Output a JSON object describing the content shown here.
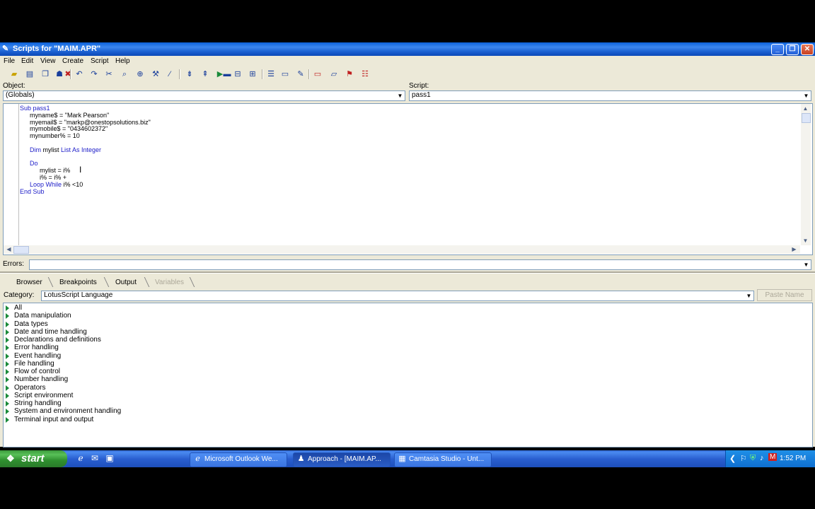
{
  "window": {
    "title": "Scripts for \"MAIM.APR\"",
    "controls": [
      "_",
      "❐",
      "✕"
    ]
  },
  "menu": [
    "File",
    "Edit",
    "View",
    "Create",
    "Script",
    "Help"
  ],
  "toolbar_icons": [
    "open-icon",
    "new-icon",
    "copy-icon",
    "paste-icon",
    "user-icon",
    "delete-icon",
    "undo-icon",
    "redo-icon",
    "cut-icon",
    "find-icon",
    "replace-icon",
    "browse-icon",
    "tools-icon",
    "wand-icon",
    "step-into-icon",
    "step-over-icon",
    "run-icon",
    "stop-icon",
    "breakpoint-icon",
    "watch-icon",
    "list-icon",
    "window-icon",
    "edit-icon",
    "button-icon",
    "field-icon",
    "macro-icon",
    "properties-icon"
  ],
  "object": {
    "label": "Object:",
    "value": "(Globals)"
  },
  "script": {
    "label": "Script:",
    "value": "pass1"
  },
  "code_lines": [
    {
      "indent": 0,
      "parts": [
        {
          "t": "Sub pass1",
          "kw": true
        }
      ]
    },
    {
      "indent": 1,
      "parts": [
        {
          "t": "myname$ = \"Mark Pearson\"",
          "kw": false
        }
      ]
    },
    {
      "indent": 1,
      "parts": [
        {
          "t": "myemail$ = \"markp@onestopsolutions.biz\"",
          "kw": false
        }
      ]
    },
    {
      "indent": 1,
      "parts": [
        {
          "t": "mymobile$ = \"0434602372\"",
          "kw": false
        }
      ]
    },
    {
      "indent": 1,
      "parts": [
        {
          "t": "mynumber% = 10",
          "kw": false
        }
      ]
    },
    {
      "indent": 1,
      "parts": []
    },
    {
      "indent": 1,
      "parts": [
        {
          "t": "Dim ",
          "kw": true
        },
        {
          "t": "mylist ",
          "kw": false
        },
        {
          "t": "List As Integer",
          "kw": true
        }
      ]
    },
    {
      "indent": 1,
      "parts": []
    },
    {
      "indent": 1,
      "parts": [
        {
          "t": "Do",
          "kw": true
        }
      ]
    },
    {
      "indent": 2,
      "parts": [
        {
          "t": "mylist = i%",
          "kw": false
        }
      ]
    },
    {
      "indent": 2,
      "parts": [
        {
          "t": "i% = i% +",
          "kw": false
        }
      ]
    },
    {
      "indent": 1,
      "parts": [
        {
          "t": "Loop While ",
          "kw": true
        },
        {
          "t": "i% <10",
          "kw": false
        }
      ]
    },
    {
      "indent": 0,
      "parts": [
        {
          "t": "End Sub",
          "kw": true
        }
      ]
    }
  ],
  "errors": {
    "label": "Errors:",
    "value": ""
  },
  "tabs": [
    {
      "label": "Browser",
      "enabled": true
    },
    {
      "label": "Breakpoints",
      "enabled": true
    },
    {
      "label": "Output",
      "enabled": true
    },
    {
      "label": "Variables",
      "enabled": false
    }
  ],
  "category": {
    "label": "Category:",
    "value": "LotusScript Language",
    "paste_label": "Paste Name"
  },
  "categories": [
    "All",
    "Data manipulation",
    "Data types",
    "Date and time handling",
    "Declarations and definitions",
    "Error handling",
    "Event handling",
    "File handling",
    "Flow of control",
    "Number handling",
    "Operators",
    "Script environment",
    "String handling",
    "System and environment handling",
    "Terminal input and output"
  ],
  "taskbar": {
    "start_label": "start",
    "buttons": [
      {
        "label": "Microsoft Outlook We...",
        "icon": "outlook-icon",
        "active": false
      },
      {
        "label": "Approach - [MAIM.AP...",
        "icon": "approach-icon",
        "active": true
      },
      {
        "label": "Camtasia Studio - Unt...",
        "icon": "camtasia-icon",
        "active": false
      }
    ],
    "clock": "1:52 PM"
  },
  "colors": {
    "keyword": "#1c1cc8",
    "titlebar": "#0a5fd8",
    "taskbar": "#2a5fd0",
    "start": "#3c9a3c"
  }
}
